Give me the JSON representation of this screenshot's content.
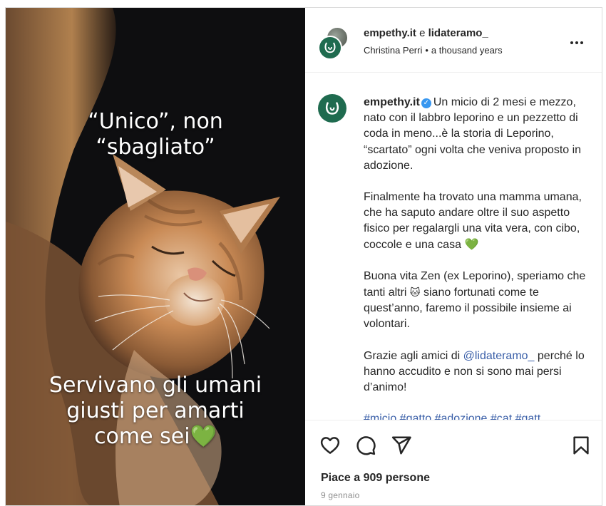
{
  "post": {
    "overlay_top": "“Unico”, non “sbagliato”",
    "overlay_bottom_line1": "Servivano gli umani",
    "overlay_bottom_line2": "giusti per amarti",
    "overlay_bottom_line3": "come sei",
    "overlay_heart": "💚"
  },
  "header": {
    "user1": "empethy.it",
    "conjunction": "e",
    "user2": "lidateramo_",
    "song_artist": "Christina Perri",
    "song_title": "a thousand years"
  },
  "caption": {
    "username": "empethy.it",
    "p1": "Un micio di 2 mesi e mezzo, nato con il labbro leporino e un pezzetto di coda in meno...è la storia di Leporino, “scartato” ogni volta che veniva proposto in adozione.",
    "p2": "Finalmente ha trovato una mamma umana, che ha saputo andare oltre il suo aspetto fisico per regalargli una vita vera, con cibo, coccole e una casa",
    "p2_emoji": "💚",
    "p3_a": "Buona vita Zen (ex Leporino), speriamo che tanti altri",
    "p3_emoji": "🐱",
    "p3_b": "siano fortunati come te quest’anno, faremo il possibile insieme ai volontari.",
    "p4_a": "Grazie agli amici di",
    "p4_mention": "@lidateramo_",
    "p4_b": "perché lo hanno accudito e non si sono mai persi d’animo!",
    "hashtags": "#micio #gatto #adozione #cat #gatt"
  },
  "footer": {
    "likes": "Piace a 909 persone",
    "date": "9 gennaio"
  },
  "icons": {
    "like": "heart-outline-icon",
    "comment": "comment-bubble-icon",
    "share": "paper-plane-icon",
    "save": "bookmark-icon",
    "more": "more-dots-icon",
    "verified": "verified-badge-icon"
  },
  "colors": {
    "brand_green": "#1f6b4f",
    "link_blue": "#3a5fa8",
    "verified_blue": "#3897f0"
  }
}
